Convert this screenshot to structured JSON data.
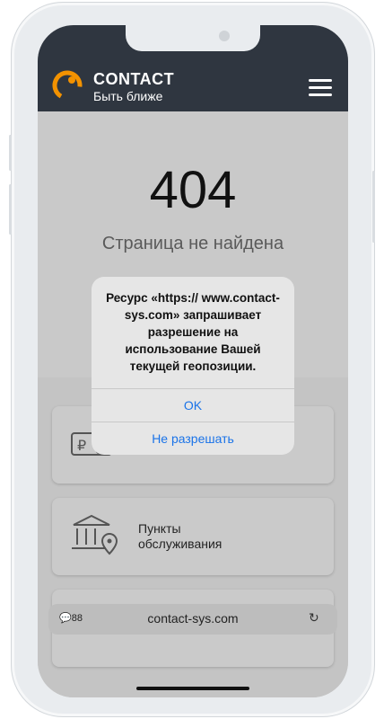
{
  "header": {
    "brand_name": "CONTACT",
    "tagline": "Быть ближе"
  },
  "error": {
    "code": "404",
    "message": "Страница не найдена"
  },
  "dialog": {
    "message": "Ресурс «https:// www.contact-sys.com» запрашивает разрешение на использование Вашей текущей геопозиции.",
    "ok_label": "OK",
    "deny_label": "Не разрешать"
  },
  "cards": [
    {
      "icon": "card-payment-icon",
      "label": ""
    },
    {
      "icon": "bank-location-icon",
      "label": "Пункты обслуживания"
    }
  ],
  "browser": {
    "badge_count": "88",
    "url": "contact-sys.com"
  },
  "colors": {
    "header_bg": "#2f3640",
    "accent": "#f39200",
    "link": "#1a73e8"
  }
}
